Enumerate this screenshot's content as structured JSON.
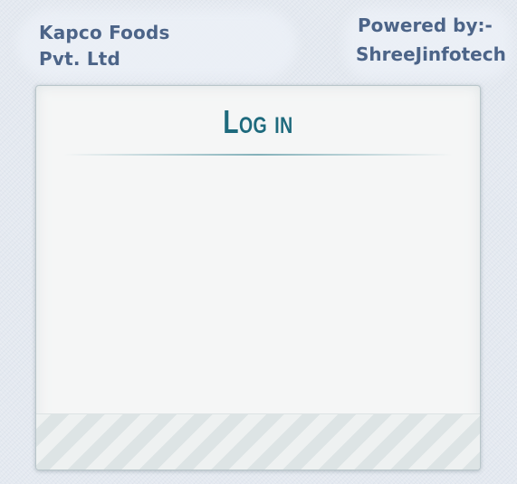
{
  "header": {
    "company_line1": "Kapco Foods",
    "company_line2": "Pvt. Ltd",
    "powered_by_label": "Powered by:-",
    "powered_by_brand": "ShreeJinfotech"
  },
  "login": {
    "title": "Log in"
  }
}
